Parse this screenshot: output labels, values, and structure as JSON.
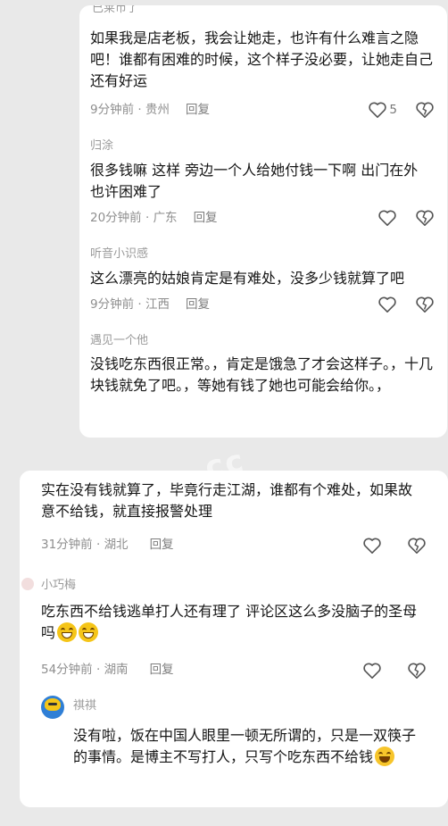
{
  "card_top": {
    "partial_username": "已莱币了",
    "comments": [
      {
        "username": "",
        "text": "如果我是店老板，我会让她走，也许有什么难言之隐吧！谁都有困难的时候，这个样子没必要，让她走自己还有好运",
        "time": "9分钟前",
        "location": "贵州",
        "reply_label": "回复",
        "likes": "5"
      },
      {
        "username": "归涂",
        "text": "很多钱嘛 这样 旁边一个人给她付钱一下啊 出门在外 也许困难了",
        "time": "20分钟前",
        "location": "广东",
        "reply_label": "回复",
        "likes": ""
      },
      {
        "username": "听音小识感",
        "text": "这么漂亮的姑娘肯定是有难处，没多少钱就算了吧",
        "time": "9分钟前",
        "location": "江西",
        "reply_label": "回复",
        "likes": ""
      },
      {
        "username": "遇见一个他",
        "text": "没钱吃东西很正常。，肯定是饿急了才会这样子。，十几块钱就免了吧。，等她有钱了她也可能会给你。，",
        "time": "",
        "location": "",
        "reply_label": "",
        "likes": ""
      }
    ]
  },
  "card_bottom": {
    "comments": [
      {
        "username": "",
        "text": "实在没有钱就算了，毕竟行走江湖，谁都有个难处，如果故意不给钱，就直接报警处理",
        "time": "31分钟前",
        "location": "湖北",
        "reply_label": "回复",
        "likes": ""
      },
      {
        "username": "小巧梅",
        "text": "吃东西不给钱逃单打人还有理了 评论区这么多没脑子的圣母吗",
        "time": "54分钟前",
        "location": "湖南",
        "reply_label": "回复",
        "likes": ""
      },
      {
        "username": "祺祺",
        "text": "没有啦，饭在中国人眼里一顿无所谓的，只是一双筷子的事情。是博主不写打人，只写个吃东西不给钱",
        "time": "",
        "location": "",
        "reply_label": "",
        "likes": ""
      }
    ]
  },
  "separator": " · ",
  "icons": {
    "like": "heart-icon",
    "dislike": "broken-heart-icon"
  },
  "colors": {
    "background": "#e9e9e9",
    "card": "#ffffff",
    "meta_text": "#8e8e8e",
    "icon": "#5a5a5a"
  }
}
